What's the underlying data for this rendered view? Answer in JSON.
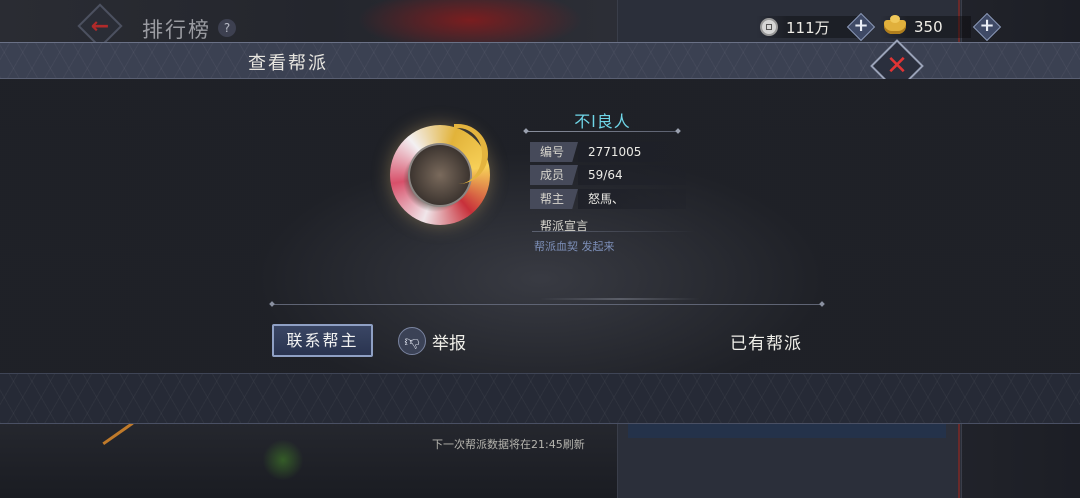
{
  "top_bar": {
    "back_icon": "left-arrow-icon",
    "title": "排行榜",
    "help": "?",
    "currencies": [
      {
        "icon": "copper-coin-icon",
        "value": "111万"
      },
      {
        "icon": "gold-ingot-icon",
        "value": "350"
      }
    ],
    "plus": "+"
  },
  "modal": {
    "title": "查看帮派",
    "close": "✕",
    "guild": {
      "name": "不l良人",
      "rows": [
        {
          "label": "编号",
          "value": "2771005"
        },
        {
          "label": "成员",
          "value": "59/64"
        },
        {
          "label": "帮主",
          "value": "怒馬、"
        }
      ],
      "declaration_title": "帮派宣言",
      "declaration": "帮派血契 发起来"
    },
    "buttons": {
      "contact": "联系帮主",
      "report": "举报",
      "report_icon": "thumbs-down-icon"
    },
    "status": "已有帮派"
  },
  "footer": {
    "refresh_note": "下一次帮派数据将在21:45刷新"
  },
  "colors": {
    "guild_name": "#6fd6e8",
    "close_x": "#e13434",
    "back_arrow": "#b02a2a",
    "declaration": "#7d8fb8"
  }
}
